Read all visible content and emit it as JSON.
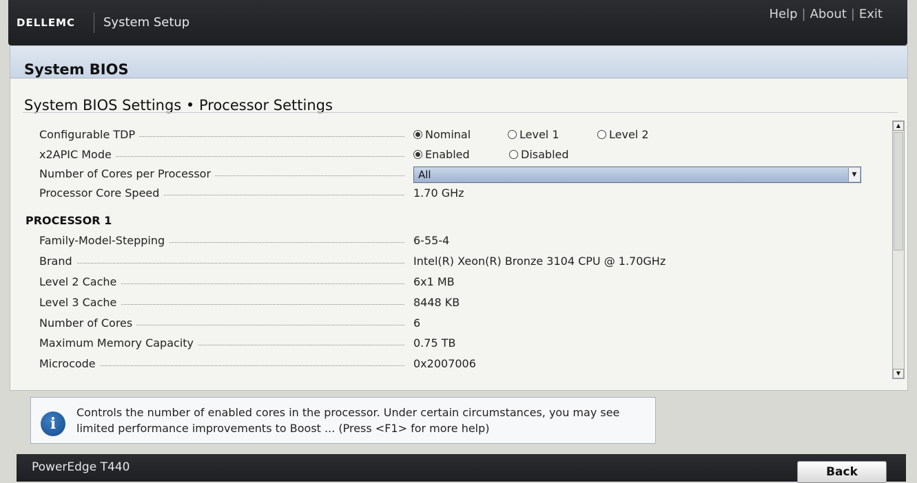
{
  "header": {
    "brand": "DELLEMC",
    "app_title": "System Setup",
    "links": [
      "Help",
      "About",
      "Exit"
    ]
  },
  "panel": {
    "title": "System BIOS",
    "subtitle": "System BIOS Settings • Processor Settings"
  },
  "settings": {
    "tdp": {
      "label": "Configurable TDP",
      "options": [
        "Nominal",
        "Level 1",
        "Level 2"
      ],
      "selected": "Nominal"
    },
    "x2apic": {
      "label": "x2APIC Mode",
      "options": [
        "Enabled",
        "Disabled"
      ],
      "selected": "Enabled"
    },
    "cores_per_processor": {
      "label": "Number of Cores per Processor",
      "value": "All"
    },
    "core_speed": {
      "label": "Processor Core Speed",
      "value": "1.70 GHz"
    }
  },
  "processor1": {
    "heading": "PROCESSOR 1",
    "rows": [
      {
        "label": "Family-Model-Stepping",
        "value": "6-55-4"
      },
      {
        "label": "Brand",
        "value": "Intel(R) Xeon(R) Bronze 3104 CPU @ 1.70GHz"
      },
      {
        "label": "Level 2 Cache",
        "value": "6x1 MB"
      },
      {
        "label": "Level 3 Cache",
        "value": "8448 KB"
      },
      {
        "label": "Number of Cores",
        "value": "6"
      },
      {
        "label": "Maximum Memory Capacity",
        "value": "0.75 TB"
      },
      {
        "label": "Microcode",
        "value": "0x2007006"
      }
    ]
  },
  "help": {
    "text": "Controls the number of enabled cores in the processor. Under certain circumstances, you may see limited performance improvements to Boost ... (Press <F1> for more help)"
  },
  "footer": {
    "model": "PowerEdge T440",
    "back_label": "Back"
  }
}
